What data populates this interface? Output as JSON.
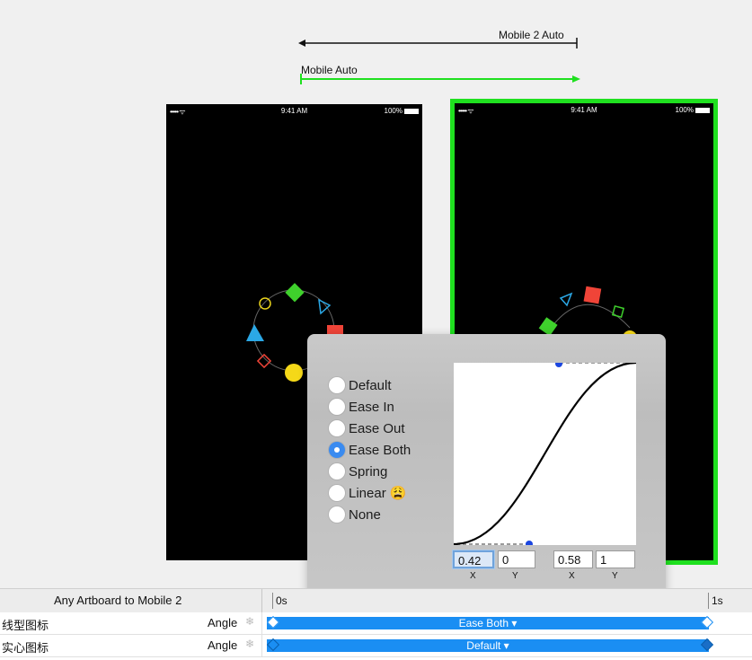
{
  "arrows": {
    "mobile2_label": "Mobile 2 Auto",
    "mobile_label": "Mobile Auto"
  },
  "phone_status": {
    "signal": "••••• ᯤ",
    "time": "9:41 AM",
    "battery": "100%"
  },
  "curve_panel": {
    "options": [
      {
        "label": "Default",
        "selected": false
      },
      {
        "label": "Ease In",
        "selected": false
      },
      {
        "label": "Ease Out",
        "selected": false
      },
      {
        "label": "Ease Both",
        "selected": true
      },
      {
        "label": "Spring",
        "selected": false
      },
      {
        "label": "Linear 😩",
        "selected": false
      },
      {
        "label": "None",
        "selected": false
      }
    ],
    "fields": {
      "x1": "0.42",
      "y1": "0",
      "x2": "0.58",
      "y2": "1"
    },
    "field_labels": {
      "x1": "X",
      "y1": "Y",
      "x2": "X",
      "y2": "Y"
    }
  },
  "timeline": {
    "header_title": "Any Artboard to Mobile 2",
    "start_label": "0s",
    "end_label": "1s",
    "rows": [
      {
        "name": "线型图标",
        "property": "Angle",
        "curve_label": "Ease Both ▾"
      },
      {
        "name": "实心图标",
        "property": "Angle",
        "curve_label": "Default ▾"
      }
    ]
  },
  "colors": {
    "accent_green": "#1fe01f",
    "accent_blue": "#1a8ef3",
    "radio_selected": "#3a8bf0"
  }
}
